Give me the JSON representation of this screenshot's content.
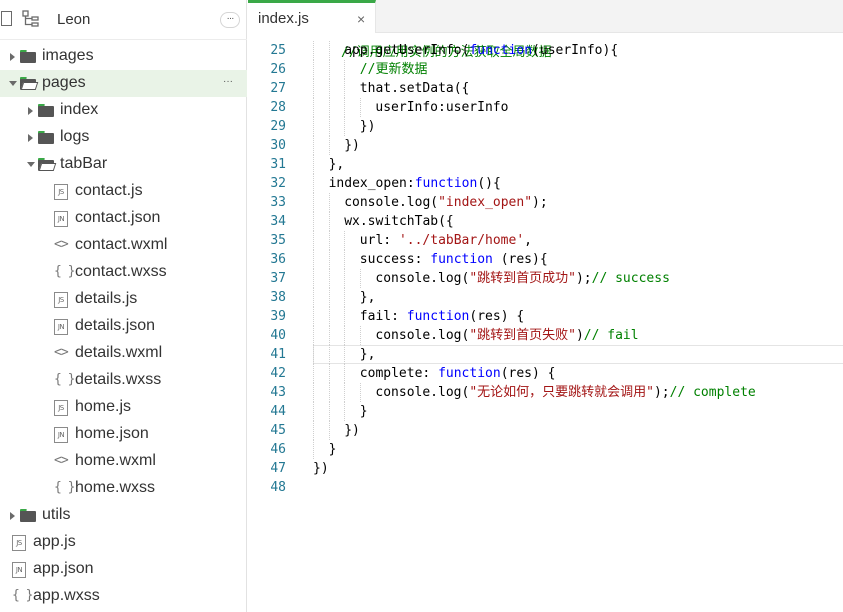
{
  "sidebar": {
    "title": "Leon",
    "more_label": "···",
    "tree": [
      {
        "label": "images",
        "type": "folder",
        "state": "collapsed",
        "depth": 0
      },
      {
        "label": "pages",
        "type": "folder",
        "state": "expanded",
        "depth": 0,
        "selected": true
      },
      {
        "label": "index",
        "type": "folder",
        "state": "collapsed",
        "depth": 1
      },
      {
        "label": "logs",
        "type": "folder",
        "state": "collapsed",
        "depth": 1
      },
      {
        "label": "tabBar",
        "type": "folder",
        "state": "expanded",
        "depth": 1
      },
      {
        "label": "contact.js",
        "type": "js",
        "depth": 2
      },
      {
        "label": "contact.json",
        "type": "json",
        "depth": 2
      },
      {
        "label": "contact.wxml",
        "type": "wxml",
        "depth": 2
      },
      {
        "label": "contact.wxss",
        "type": "wxss",
        "depth": 2
      },
      {
        "label": "details.js",
        "type": "js",
        "depth": 2
      },
      {
        "label": "details.json",
        "type": "json",
        "depth": 2
      },
      {
        "label": "details.wxml",
        "type": "wxml",
        "depth": 2
      },
      {
        "label": "details.wxss",
        "type": "wxss",
        "depth": 2
      },
      {
        "label": "home.js",
        "type": "js",
        "depth": 2
      },
      {
        "label": "home.json",
        "type": "json",
        "depth": 2
      },
      {
        "label": "home.wxml",
        "type": "wxml",
        "depth": 2
      },
      {
        "label": "home.wxss",
        "type": "wxss",
        "depth": 2
      },
      {
        "label": "utils",
        "type": "folder",
        "state": "collapsed",
        "depth": 0
      },
      {
        "label": "app.js",
        "type": "js",
        "depth": 0
      },
      {
        "label": "app.json",
        "type": "json",
        "depth": 0
      },
      {
        "label": "app.wxss",
        "type": "wxss",
        "depth": 0
      }
    ],
    "icon_text": {
      "js": "JS",
      "json": "JN",
      "wxml": "<>",
      "wxss": "{ }"
    }
  },
  "editor": {
    "tab": {
      "label": "index.js",
      "close": "×"
    },
    "current_line": 41,
    "lines": [
      {
        "n": "25",
        "indent": 4,
        "tokens": [
          [
            "app.getUserInfo(",
            ""
          ],
          [
            "function",
            "kw"
          ],
          [
            "(userInfo){",
            ""
          ]
        ]
      },
      {
        "n": "26",
        "indent": 6,
        "tokens": [
          [
            "//更新数据",
            "cm"
          ]
        ]
      },
      {
        "n": "27",
        "indent": 6,
        "tokens": [
          [
            "that.setData({",
            ""
          ]
        ]
      },
      {
        "n": "28",
        "indent": 8,
        "tokens": [
          [
            "userInfo:userInfo",
            ""
          ]
        ]
      },
      {
        "n": "29",
        "indent": 6,
        "tokens": [
          [
            "})",
            ""
          ]
        ]
      },
      {
        "n": "30",
        "indent": 4,
        "tokens": [
          [
            "})",
            ""
          ]
        ]
      },
      {
        "n": "31",
        "indent": 2,
        "tokens": [
          [
            "},",
            ""
          ]
        ]
      },
      {
        "n": "32",
        "indent": 2,
        "tokens": [
          [
            "index_open:",
            ""
          ],
          [
            "function",
            "kw"
          ],
          [
            "(){",
            ""
          ]
        ]
      },
      {
        "n": "33",
        "indent": 4,
        "tokens": [
          [
            "console.log(",
            ""
          ],
          [
            "\"index_open\"",
            "str"
          ],
          [
            ");",
            ""
          ]
        ]
      },
      {
        "n": "34",
        "indent": 4,
        "tokens": [
          [
            "wx.switchTab({",
            ""
          ]
        ]
      },
      {
        "n": "35",
        "indent": 6,
        "tokens": [
          [
            "url: ",
            ""
          ],
          [
            "'../tabBar/home'",
            "str"
          ],
          [
            ",",
            ""
          ]
        ]
      },
      {
        "n": "36",
        "indent": 6,
        "tokens": [
          [
            "success: ",
            ""
          ],
          [
            "function",
            "kw"
          ],
          [
            " (res){",
            ""
          ]
        ]
      },
      {
        "n": "37",
        "indent": 8,
        "tokens": [
          [
            "console.log(",
            ""
          ],
          [
            "\"跳转到首页成功\"",
            "str"
          ],
          [
            ");",
            ""
          ],
          [
            "// success",
            "cm"
          ]
        ]
      },
      {
        "n": "38",
        "indent": 6,
        "tokens": [
          [
            "},",
            ""
          ]
        ]
      },
      {
        "n": "39",
        "indent": 6,
        "tokens": [
          [
            "fail: ",
            ""
          ],
          [
            "function",
            "kw"
          ],
          [
            "(res) {",
            ""
          ]
        ]
      },
      {
        "n": "40",
        "indent": 8,
        "tokens": [
          [
            "console.log(",
            ""
          ],
          [
            "\"跳转到首页失败\"",
            "str"
          ],
          [
            ")",
            ""
          ],
          [
            "// fail",
            "cm"
          ]
        ]
      },
      {
        "n": "41",
        "indent": 6,
        "tokens": [
          [
            "},",
            ""
          ]
        ]
      },
      {
        "n": "42",
        "indent": 6,
        "tokens": [
          [
            "complete: ",
            ""
          ],
          [
            "function",
            "kw"
          ],
          [
            "(res) {",
            ""
          ]
        ]
      },
      {
        "n": "43",
        "indent": 8,
        "tokens": [
          [
            "console.log(",
            ""
          ],
          [
            "\"无论如何，只要跳转就会调用\"",
            "str"
          ],
          [
            ");",
            ""
          ],
          [
            "// complete",
            "cm"
          ]
        ]
      },
      {
        "n": "44",
        "indent": 6,
        "tokens": [
          [
            "}",
            ""
          ]
        ]
      },
      {
        "n": "45",
        "indent": 4,
        "tokens": [
          [
            "})",
            ""
          ]
        ]
      },
      {
        "n": "46",
        "indent": 2,
        "tokens": [
          [
            "}",
            ""
          ]
        ]
      },
      {
        "n": "47",
        "indent": 0,
        "tokens": [
          [
            "})",
            ""
          ]
        ]
      },
      {
        "n": "48",
        "indent": 0,
        "tokens": []
      }
    ]
  },
  "colors": {
    "accent": "#3aa847",
    "selected_bg": "#e9f3e7",
    "keyword": "#0000ff",
    "string": "#a31515",
    "comment": "#008000",
    "line_number": "#237893"
  }
}
